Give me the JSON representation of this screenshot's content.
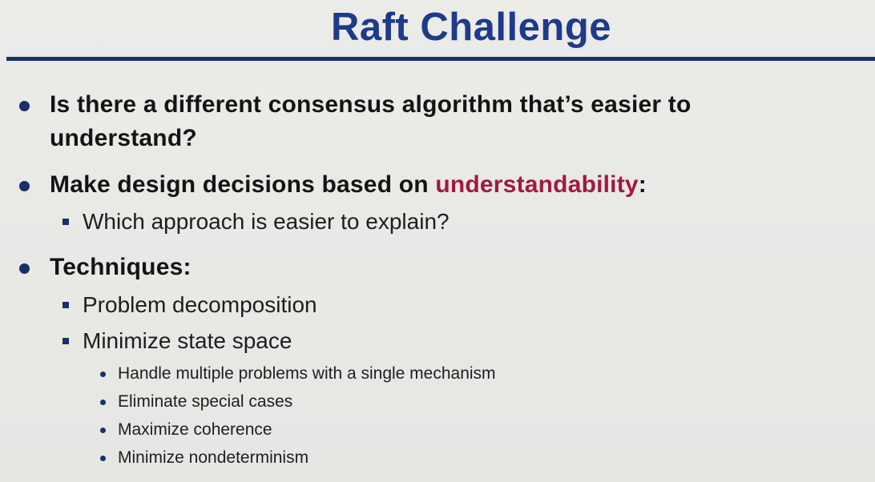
{
  "title": "Raft Challenge",
  "bullets": {
    "q_line1": "Is there a different consensus algorithm that’s easier to",
    "q_line2": "understand?",
    "design_prefix": "Make design decisions based on ",
    "design_highlight": "understandability",
    "design_suffix": ":",
    "design_sub": "Which approach is easier to explain?",
    "techniques": "Techniques:",
    "tech_sub1": "Problem decomposition",
    "tech_sub2": "Minimize state space",
    "tech_sub2_items": [
      "Handle multiple problems with a single mechanism",
      "Eliminate special cases",
      "Maximize coherence",
      "Minimize nondeterminism"
    ]
  },
  "colors": {
    "title": "#1f3a8a",
    "rule": "#1c2f6e",
    "highlight": "#a11a3e",
    "bullet": "#1b2e6a"
  }
}
